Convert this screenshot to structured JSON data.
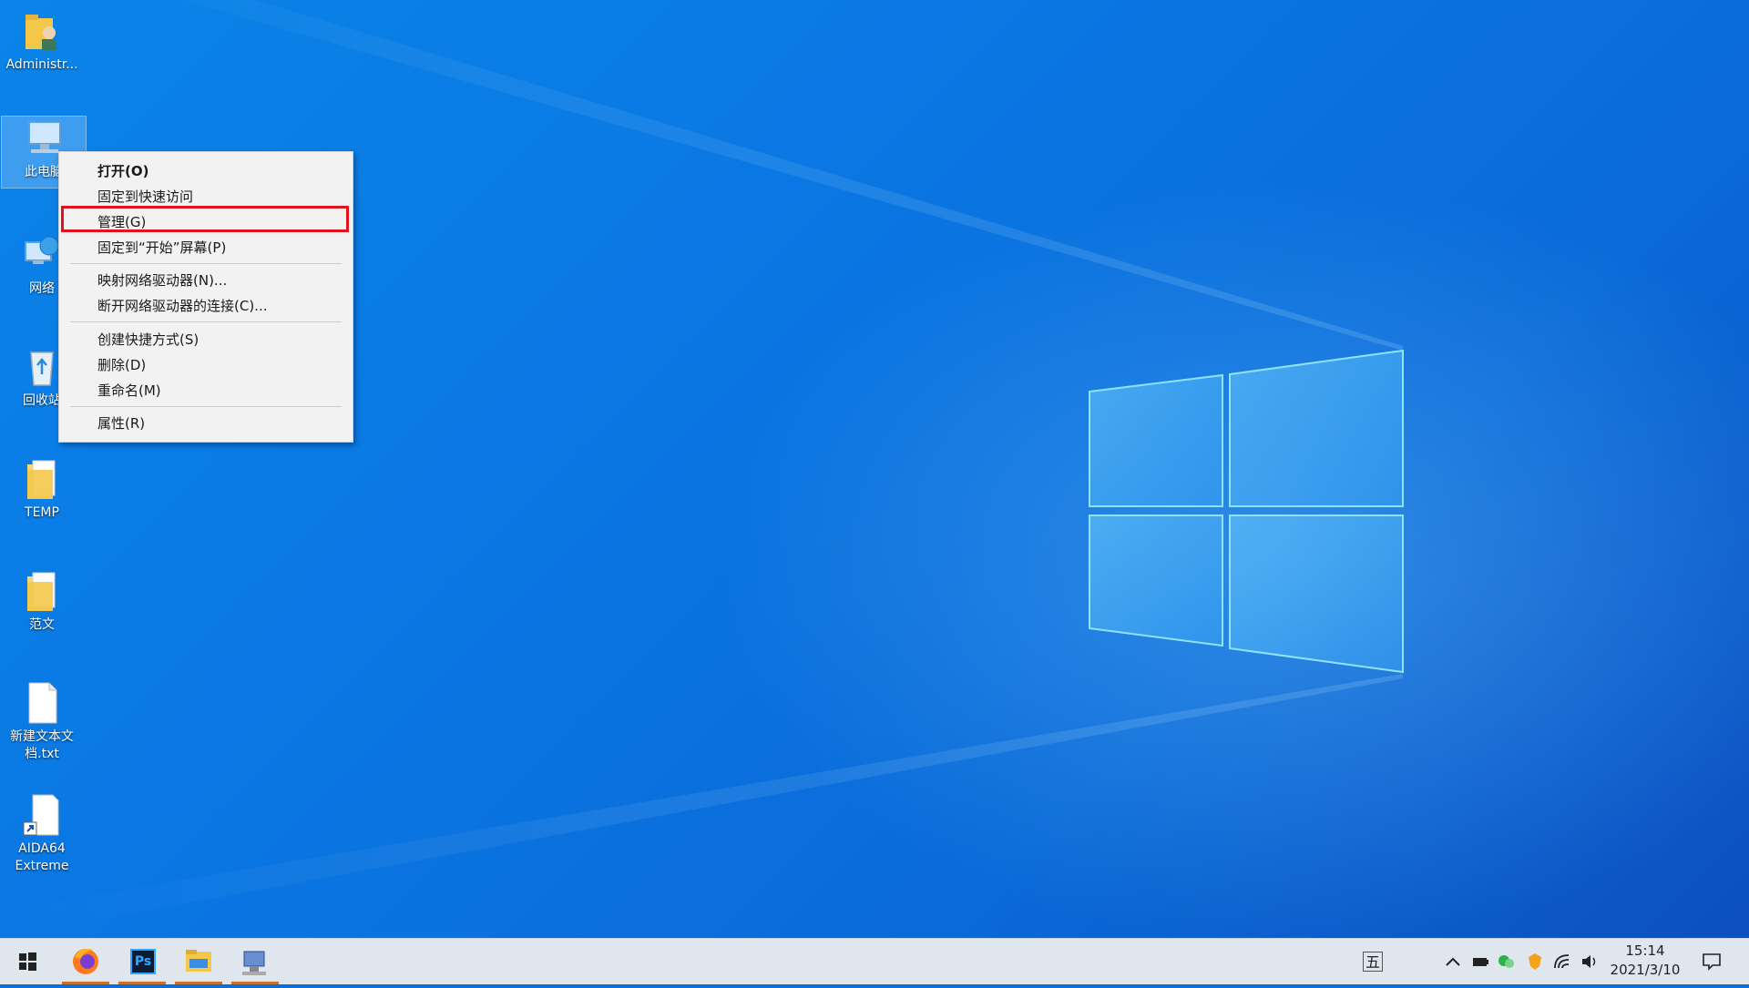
{
  "desktop": {
    "icons": [
      {
        "label": "Administr..."
      },
      {
        "label": "此电脑"
      },
      {
        "label": "网络"
      },
      {
        "label": "回收站"
      },
      {
        "label": "TEMP"
      },
      {
        "label": "范文"
      },
      {
        "label": "新建文本文档.txt"
      },
      {
        "label": "AIDA64 Extreme"
      }
    ]
  },
  "context_menu": {
    "items": [
      {
        "label": "打开(O)"
      },
      {
        "label": "固定到快速访问"
      },
      {
        "label": "管理(G)"
      },
      {
        "label": "固定到“开始”屏幕(P)"
      },
      {
        "label": "映射网络驱动器(N)..."
      },
      {
        "label": "断开网络驱动器的连接(C)..."
      },
      {
        "label": "创建快捷方式(S)"
      },
      {
        "label": "删除(D)"
      },
      {
        "label": "重命名(M)"
      },
      {
        "label": "属性(R)"
      }
    ],
    "highlight_color": "#e0121b"
  },
  "taskbar": {
    "apps": [
      {
        "icon": "start-windows-icon"
      },
      {
        "icon": "firefox-icon"
      },
      {
        "icon": "photoshop-icon",
        "text": "Ps"
      },
      {
        "icon": "file-explorer-icon"
      },
      {
        "icon": "network-app-icon"
      }
    ],
    "ime_label": "五",
    "clock": {
      "time": "15:14",
      "date": "2021/3/10"
    }
  },
  "colors": {
    "wallpaper": "#0a78e4",
    "taskbar": "#dfe6ee",
    "accent_underline": "#c7732c"
  }
}
